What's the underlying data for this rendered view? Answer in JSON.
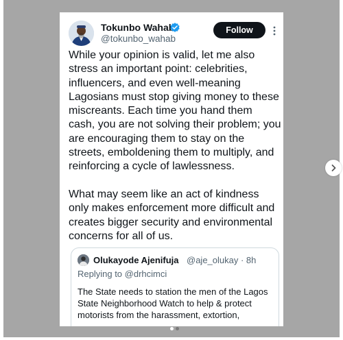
{
  "tweet": {
    "author_name": "Tokunbo Wahab",
    "handle": "@tokunbo_wahab",
    "follow_label": "Follow",
    "paragraph_1": "While your opinion is valid, let me also stress an important point: celebrities, influencers, and even well-meaning Lagosians must stop giving money to these miscreants. Each time you hand them cash, you are not solving their problem; you are encouraging them to stay on the streets, emboldening them to multiply, and reinforcing a cycle of lawlessness.",
    "paragraph_2": "What may seem like an act of kindness only makes enforcement more difficult and creates bigger security and environmental concerns for all of us."
  },
  "quoted": {
    "author_name": "Olukayode Ajenifuja",
    "meta": "@aje_olukay · 8h",
    "reply_prefix": "Replying to",
    "reply_handle": "@drhcimci",
    "text": "The State needs to station the men of the Lagos State Neighborhood Watch to help & protect motorists from the harassment, extortion,"
  },
  "carousel": {
    "slide_count": 2,
    "current_slide": 1
  },
  "colors": {
    "verified": "#1d9bf0",
    "follow_bg": "#0f1419",
    "secondary_text": "#536471",
    "backdrop": "#a6a6a6"
  },
  "icons": {
    "verified": "verified-badge-icon",
    "more": "more-options-icon",
    "next": "chevron-right-icon"
  }
}
